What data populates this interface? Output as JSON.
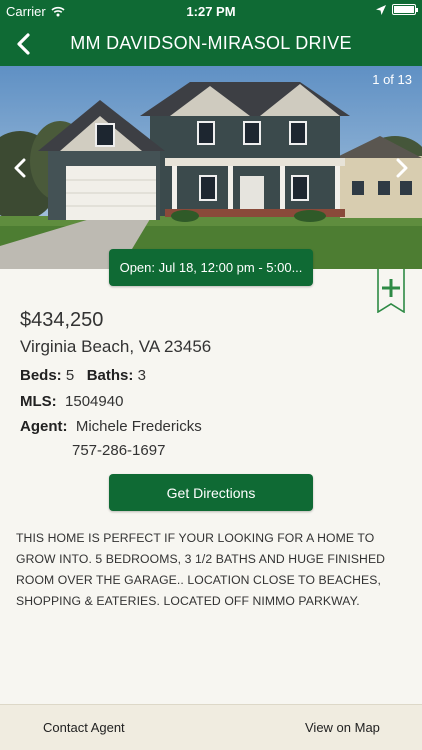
{
  "status": {
    "carrier": "Carrier",
    "time": "1:27 PM",
    "wifi_icon": "wifi-icon",
    "location_icon": "location-arrow-icon",
    "battery_icon": "battery-icon",
    "battery_level": 1.0
  },
  "nav": {
    "title": "MM DAVIDSON-MIRASOL DRIVE",
    "back_icon": "chevron-left-icon"
  },
  "photo": {
    "counter": "1 of 13",
    "current": 1,
    "total": 13,
    "prev_icon": "chevron-left-icon",
    "next_icon": "chevron-right-icon"
  },
  "open_house": "Open: Jul 18, 12:00 pm - 5:00...",
  "bookmark_icon": "bookmark-add-icon",
  "listing": {
    "price": "$434,250",
    "city": "Virginia Beach, VA 23456",
    "beds_label": "Beds:",
    "beds": "5",
    "baths_label": "Baths:",
    "baths": "3",
    "mls_label": "MLS:",
    "mls": "1504940",
    "agent_label": "Agent:",
    "agent_name": "Michele Fredericks",
    "agent_phone": "757-286-1697"
  },
  "directions_label": "Get Directions",
  "description": "THIS HOME IS PERFECT IF YOUR LOOKING FOR A HOME TO GROW INTO. 5 BEDROOMS, 3 1/2 BATHS AND HUGE FINISHED ROOM OVER THE GARAGE.. LOCATION CLOSE TO BEACHES, SHOPPING & EATERIES. LOCATED OFF NIMMO PARKWAY.",
  "tabs": {
    "contact": "Contact Agent",
    "map": "View on Map"
  },
  "colors": {
    "brand_green": "#0f6a34",
    "background": "#f7f6f1",
    "tabbar": "#f0ece0"
  }
}
